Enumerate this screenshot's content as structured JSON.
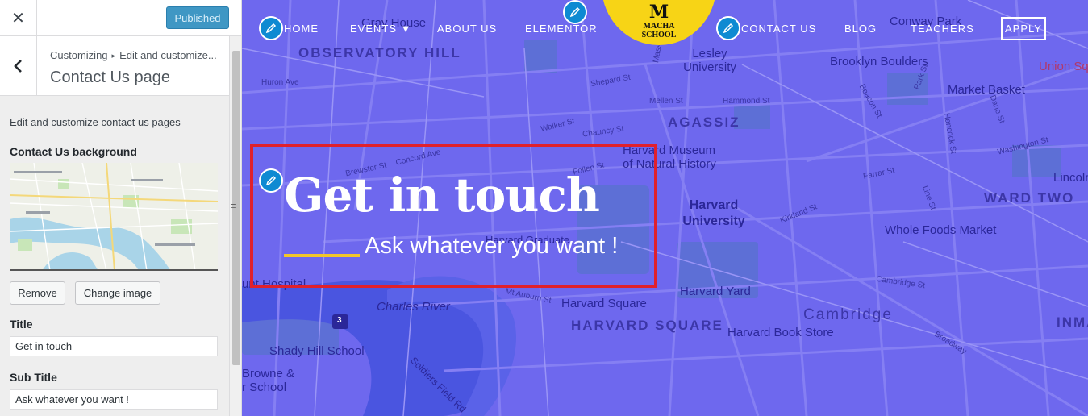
{
  "customizer": {
    "close_icon": "close-icon",
    "publish_label": "Published",
    "breadcrumb": [
      "Customizing",
      "Edit and customize..."
    ],
    "breadcrumb_sep": "▸",
    "section_title": "Contact Us page",
    "description": "Edit and customize contact us pages",
    "background_label": "Contact Us background",
    "remove_label": "Remove",
    "change_image_label": "Change image",
    "title_label": "Title",
    "title_value": "Get in touch",
    "subtitle_label": "Sub Title",
    "subtitle_value": "Ask whatever you want !",
    "accent_color": "#3f97c4"
  },
  "preview": {
    "nav": {
      "home": "HOME",
      "events": "EVENTS ▼",
      "about": "ABOUT US",
      "elementor": "ELEMENTOR",
      "contact": "CONTACT US",
      "blog": "BLOG",
      "teachers": "TEACHERS",
      "apply": "APPLY"
    },
    "logo": {
      "letter": "M",
      "line1": "MACHA",
      "line2": "SCHOOL",
      "color": "#f7d416"
    },
    "hero": {
      "title": "Get in touch",
      "subtitle": "Ask whatever you want !",
      "line_color": "#f2c62a",
      "box_color": "#e0202c"
    },
    "overlay_color": "#6e68ee",
    "map_labels": {
      "observatory": "OBSERVATORY HILL",
      "agassiz": "AGASSIZ",
      "harvard_square_big": "HARVARD SQUARE",
      "cambridge": "Cambridge",
      "ward_two": "WARD TWO",
      "inman": "INMA",
      "harvard_u": "Harvard University",
      "harvard_museum": "Harvard Museum of Natural History",
      "lesley": "Lesley University",
      "brooklyn": "Brooklyn Boulders",
      "market_basket": "Market Basket",
      "union_sq": "Union Sq",
      "lincoln": "Lincoln",
      "whole_foods": "Whole Foods Market",
      "harvard_yard": "Harvard Yard",
      "harvard_square": "Harvard Square",
      "harvard_book": "Harvard Book Store",
      "harvard_grad": "Harvard Graduate",
      "charles": "Charles River",
      "shady": "Shady Hill School",
      "browne": "Browne &",
      "school": "r School",
      "soldiers": "Soldiers Field Rd",
      "conway": "Conway Park",
      "gray": "Gray House",
      "hospital": "unt Hospital",
      "huron": "Huron Ave",
      "washington": "Washington St",
      "broadway": "Broadway",
      "cambridge_st": "Cambridge St",
      "kirkland": "Kirkland St",
      "mt_auburn": "Mt Auburn St",
      "shepard": "Shepard St",
      "mellen": "Mellen St",
      "hammond": "Hammond St",
      "beacon": "Beacon St",
      "park": "Park St",
      "dane": "Dane St",
      "brewster": "Brewster St",
      "concord": "Concord Ave",
      "follen": "Follen St",
      "walker": "Walker St",
      "chauncy": "Chauncy St",
      "route3": "3",
      "farrar": "Farrar St",
      "line": "Line St",
      "holland": "Hancock St",
      "massachusetts": "Massachusetts Ave"
    }
  }
}
